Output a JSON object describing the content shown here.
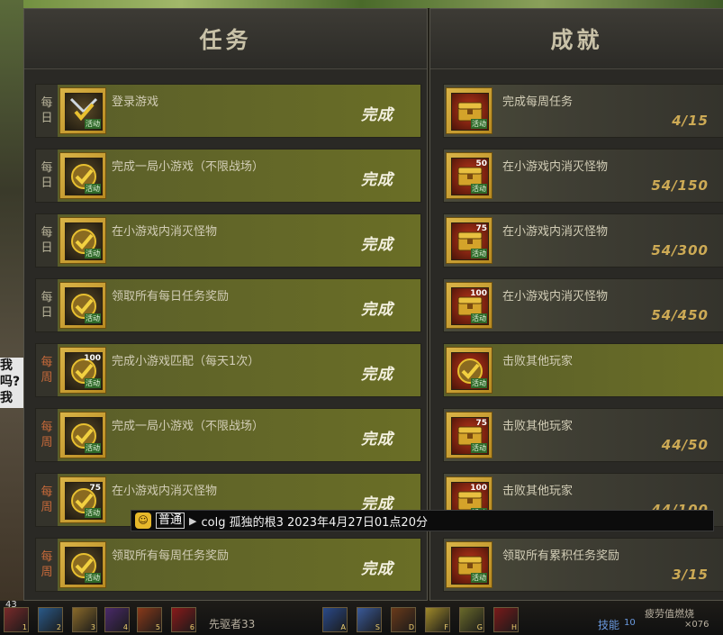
{
  "panels": {
    "tasks_title": "任务",
    "achievements_title": "成就"
  },
  "tasks": [
    {
      "freq": [
        "每",
        "日"
      ],
      "week": false,
      "label": "登录游戏",
      "status": "完成",
      "icon_tag": "活动",
      "icon": "sword-check-icon",
      "icon_num": ""
    },
    {
      "freq": [
        "每",
        "日"
      ],
      "week": false,
      "label": "完成一局小游戏（不限战场）",
      "status": "完成",
      "icon_tag": "活动",
      "icon": "check-badge-icon",
      "icon_num": ""
    },
    {
      "freq": [
        "每",
        "日"
      ],
      "week": false,
      "label": "在小游戏内消灭怪物",
      "status": "完成",
      "icon_tag": "活动",
      "icon": "check-badge-icon",
      "icon_num": ""
    },
    {
      "freq": [
        "每",
        "日"
      ],
      "week": false,
      "label": "领取所有每日任务奖励",
      "status": "完成",
      "icon_tag": "活动",
      "icon": "check-badge-icon",
      "icon_num": ""
    },
    {
      "freq": [
        "每",
        "周"
      ],
      "week": true,
      "label": "完成小游戏匹配（每天1次）",
      "status": "完成",
      "icon_tag": "活动",
      "icon": "check-badge-icon",
      "icon_num": "100"
    },
    {
      "freq": [
        "每",
        "周"
      ],
      "week": true,
      "label": "完成一局小游戏（不限战场）",
      "status": "完成",
      "icon_tag": "活动",
      "icon": "check-badge-icon",
      "icon_num": ""
    },
    {
      "freq": [
        "每",
        "周"
      ],
      "week": true,
      "label": "在小游戏内消灭怪物",
      "status": "完成",
      "icon_tag": "活动",
      "icon": "check-badge-icon",
      "icon_num": "75"
    },
    {
      "freq": [
        "每",
        "周"
      ],
      "week": true,
      "label": "领取所有每周任务奖励",
      "status": "完成",
      "icon_tag": "活动",
      "icon": "check-badge-icon",
      "icon_num": ""
    }
  ],
  "achievements": [
    {
      "label": "完成每周任务",
      "progress": "4/15",
      "done": false,
      "icon_tag": "活动",
      "icon_num": "",
      "icon": "chest-icon"
    },
    {
      "label": "在小游戏内消灭怪物",
      "progress": "54/150",
      "done": false,
      "icon_tag": "活动",
      "icon_num": "50",
      "icon": "chest-icon"
    },
    {
      "label": "在小游戏内消灭怪物",
      "progress": "54/300",
      "done": false,
      "icon_tag": "活动",
      "icon_num": "75",
      "icon": "chest-icon"
    },
    {
      "label": "在小游戏内消灭怪物",
      "progress": "54/450",
      "done": false,
      "icon_tag": "活动",
      "icon_num": "100",
      "icon": "chest-icon"
    },
    {
      "label": "击败其他玩家",
      "progress": "",
      "done": true,
      "icon_tag": "活动",
      "icon_num": "",
      "icon": "check-badge-icon"
    },
    {
      "label": "击败其他玩家",
      "progress": "44/50",
      "done": false,
      "icon_tag": "活动",
      "icon_num": "75",
      "icon": "chest-icon"
    },
    {
      "label": "击败其他玩家",
      "progress": "44/100",
      "done": false,
      "icon_tag": "活动",
      "icon_num": "100",
      "icon": "chest-icon"
    },
    {
      "label": "领取所有累积任务奖励",
      "progress": "3/15",
      "done": false,
      "icon_tag": "活动",
      "icon_num": "",
      "icon": "chest-icon"
    }
  ],
  "chat": {
    "channel": "普通",
    "text": "colg 孤独的根3 2023年4月27日01点20分"
  },
  "bottom_bar": {
    "player_name": "先驱者33",
    "skill_label": "技能",
    "skill_level": "10",
    "status_text": "疲劳值燃烧",
    "count": "×076",
    "left_level": "43",
    "hotkeys": [
      "1",
      "2",
      "3",
      "4",
      "5",
      "6",
      "A",
      "S",
      "D",
      "F",
      "G",
      "H"
    ]
  },
  "side_bubble": "我\n吗?\n我"
}
